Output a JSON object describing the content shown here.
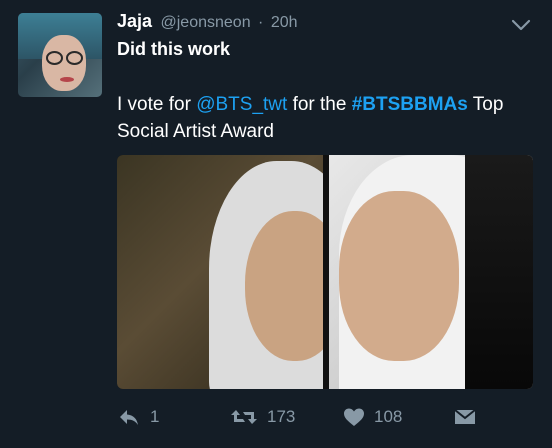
{
  "tweet": {
    "display_name": "Jaja",
    "handle": "@jeonsneon",
    "separator": "·",
    "time": "20h",
    "title": "Did this work",
    "body": {
      "prefix": "I vote for ",
      "mention": "@BTS_twt",
      "middle": " for the ",
      "hashtag": "#BTSBBMAs",
      "suffix": " Top Social Artist Award"
    }
  },
  "actions": {
    "replies": "1",
    "retweets": "173",
    "likes": "108"
  },
  "colors": {
    "background": "#141d26",
    "link": "#1da1f2",
    "muted": "#8899a6",
    "text": "#ffffff"
  },
  "icons": [
    "reply-icon",
    "retweet-icon",
    "like-icon",
    "direct-message-icon",
    "chevron-down-icon"
  ]
}
